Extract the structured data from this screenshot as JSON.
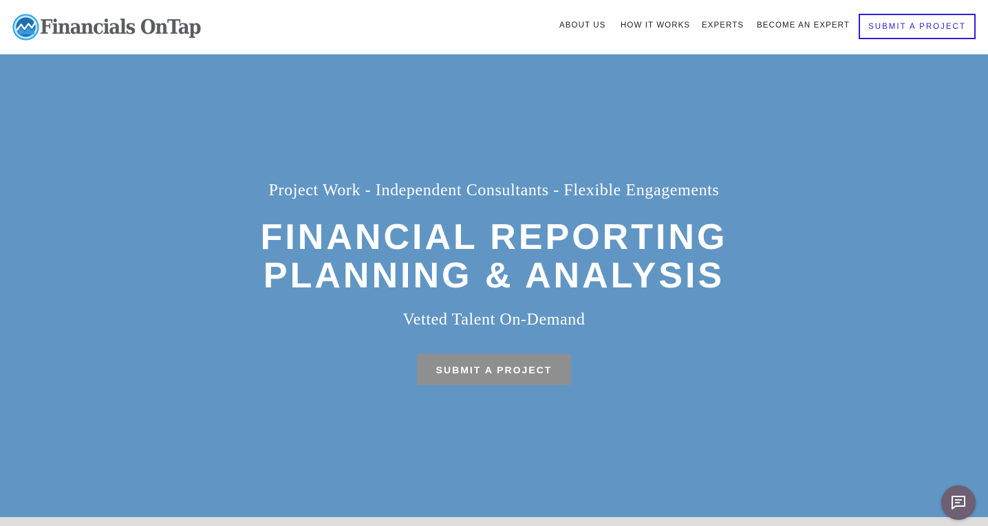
{
  "header": {
    "logo_text": "Financials OnTap",
    "nav": [
      {
        "label": "ABOUT US"
      },
      {
        "label": "HOW IT WORKS"
      },
      {
        "label": "EXPERTS"
      },
      {
        "label": "BECOME AN EXPERT"
      }
    ],
    "cta_label": "SUBMIT A PROJECT"
  },
  "hero": {
    "kicker": "Project Work - Independent Consultants - Flexible Engagements",
    "title_line1": "FINANCIAL REPORTING",
    "title_line2": "PLANNING & ANALYSIS",
    "subtitle": "Vetted Talent On-Demand",
    "button_label": "SUBMIT A PROJECT"
  },
  "chat": {
    "icon": "chat-icon"
  },
  "colors": {
    "hero_background": "#6196c4",
    "nav_cta_accent": "#2d1fd6",
    "hero_button": "#8f8f8f",
    "chat_bubble": "#6e5f73",
    "logo_blue": "#2a9be0"
  }
}
